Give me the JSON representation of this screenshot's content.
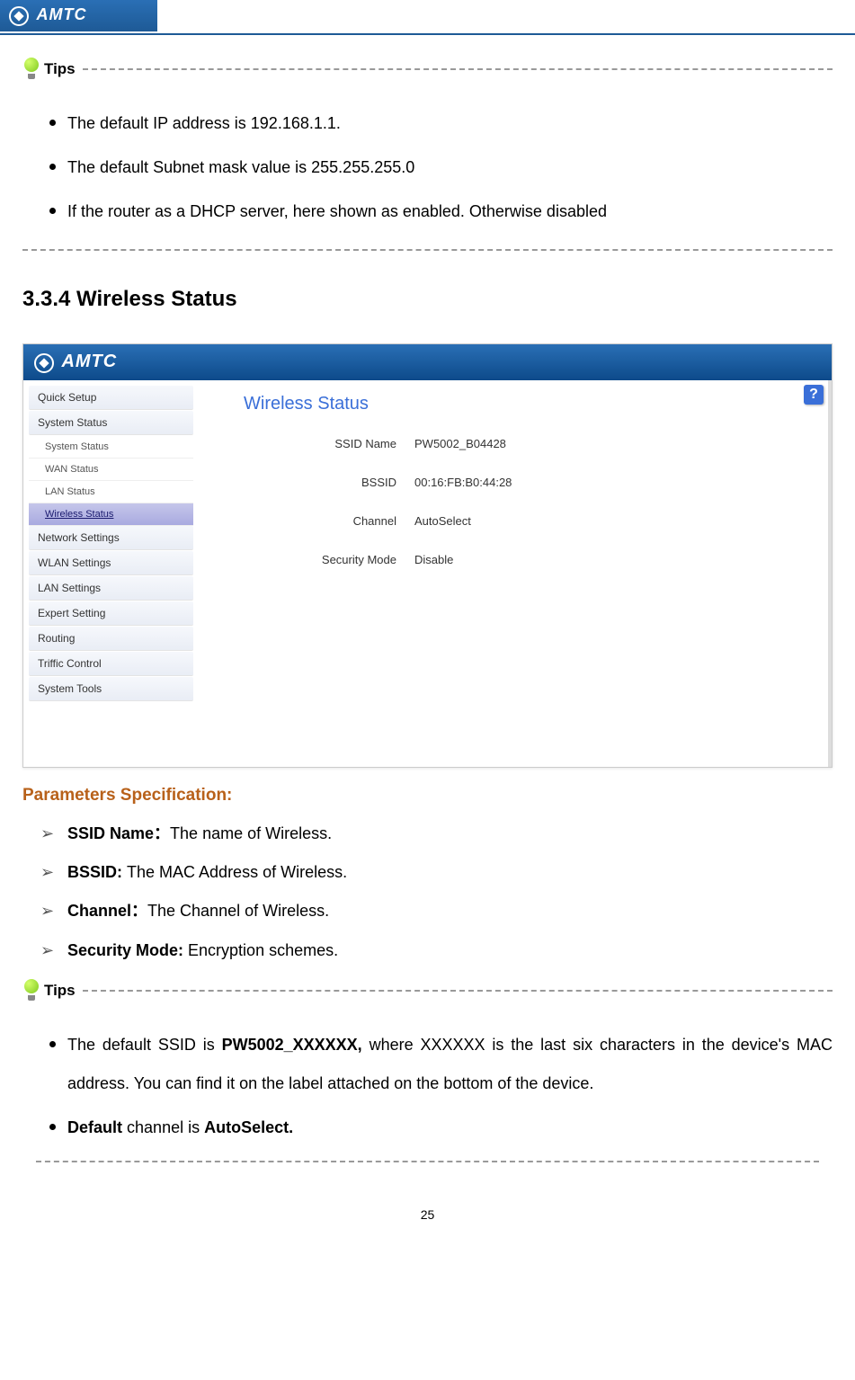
{
  "header": {
    "brand": "AMTC"
  },
  "tips1": {
    "label": "Tips",
    "items": [
      "The default IP address is 192.168.1.1.",
      "The default Subnet mask value is 255.255.255.0",
      "If the router as a DHCP server, here shown as enabled. Otherwise disabled"
    ]
  },
  "section": {
    "title": "3.3.4 Wireless Status"
  },
  "screenshot": {
    "brand": "AMTC",
    "nav": {
      "items": [
        "Quick Setup",
        "System Status"
      ],
      "sub_items": [
        "System Status",
        "WAN Status",
        "LAN Status",
        "Wireless Status"
      ],
      "items2": [
        "Network Settings",
        "WLAN Settings",
        "LAN Settings",
        "Expert Setting",
        "Routing",
        "Triffic Control",
        "System Tools"
      ]
    },
    "main": {
      "title": "Wireless Status",
      "help": "?",
      "rows": [
        {
          "label": "SSID Name",
          "value": "PW5002_B04428"
        },
        {
          "label": "BSSID",
          "value": "00:16:FB:B0:44:28"
        },
        {
          "label": "Channel",
          "value": "AutoSelect"
        },
        {
          "label": "Security Mode",
          "value": "Disable"
        }
      ]
    }
  },
  "params": {
    "title": "Parameters Specification:",
    "items": [
      {
        "label": "SSID Name：",
        "desc": "The name of Wireless."
      },
      {
        "label": "BSSID: ",
        "desc": "The MAC Address of Wireless."
      },
      {
        "label": "Channel：",
        "desc": "The Channel of Wireless."
      },
      {
        "label": "Security Mode: ",
        "desc": "Encryption schemes."
      }
    ]
  },
  "tips2": {
    "label": "Tips",
    "item1_pre": "The default SSID is ",
    "item1_bold": "PW5002_XXXXXX,",
    "item1_post": " where XXXXXX is the last six characters in the device's MAC address. You can find it on the label attached on the bottom of the device.",
    "item2_b1": "Default",
    "item2_mid": " channel is ",
    "item2_b2": "AutoSelect."
  },
  "page_number": "25"
}
